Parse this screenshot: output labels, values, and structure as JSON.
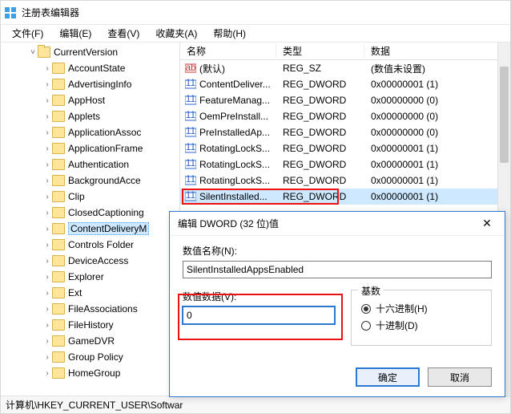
{
  "window": {
    "title": "注册表编辑器"
  },
  "menu": {
    "file": "文件(F)",
    "edit": "编辑(E)",
    "view": "查看(V)",
    "fav": "收藏夹(A)",
    "help": "帮助(H)"
  },
  "tree": {
    "root": "CurrentVersion",
    "items": [
      "AccountState",
      "AdvertisingInfo",
      "AppHost",
      "Applets",
      "ApplicationAssoc",
      "ApplicationFrame",
      "Authentication",
      "BackgroundAcce",
      "Clip",
      "ClosedCaptioning",
      "ContentDeliveryM",
      "Controls Folder",
      "DeviceAccess",
      "Explorer",
      "Ext",
      "FileAssociations",
      "FileHistory",
      "GameDVR",
      "Group Policy",
      "HomeGroup"
    ],
    "selectedIndex": 10
  },
  "columns": {
    "name": "名称",
    "type": "类型",
    "data": "数据"
  },
  "values": [
    {
      "name": "(默认)",
      "type": "REG_SZ",
      "data": "(数值未设置)",
      "icon": "str"
    },
    {
      "name": "ContentDeliver...",
      "type": "REG_DWORD",
      "data": "0x00000001 (1)",
      "icon": "dw"
    },
    {
      "name": "FeatureManag...",
      "type": "REG_DWORD",
      "data": "0x00000000 (0)",
      "icon": "dw"
    },
    {
      "name": "OemPreInstall...",
      "type": "REG_DWORD",
      "data": "0x00000000 (0)",
      "icon": "dw"
    },
    {
      "name": "PreInstalledAp...",
      "type": "REG_DWORD",
      "data": "0x00000000 (0)",
      "icon": "dw"
    },
    {
      "name": "RotatingLockS...",
      "type": "REG_DWORD",
      "data": "0x00000001 (1)",
      "icon": "dw"
    },
    {
      "name": "RotatingLockS...",
      "type": "REG_DWORD",
      "data": "0x00000001 (1)",
      "icon": "dw"
    },
    {
      "name": "RotatingLockS...",
      "type": "REG_DWORD",
      "data": "0x00000001 (1)",
      "icon": "dw"
    },
    {
      "name": "SilentInstalled...",
      "type": "REG_DWORD",
      "data": "0x00000001 (1)",
      "icon": "dw"
    }
  ],
  "selectedValueIndex": 8,
  "status": "计算机\\HKEY_CURRENT_USER\\Softwar",
  "dialog": {
    "title": "编辑 DWORD (32 位)值",
    "nameLabel": "数值名称(N):",
    "nameValue": "SilentInstalledAppsEnabled",
    "dataLabel": "数值数据(V):",
    "dataValue": "0",
    "baseLabel": "基数",
    "hex": "十六进制(H)",
    "dec": "十进制(D)",
    "ok": "确定",
    "cancel": "取消"
  }
}
